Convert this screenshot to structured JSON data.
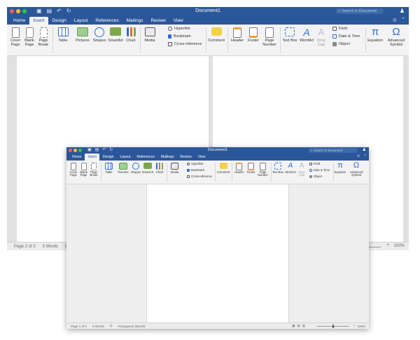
{
  "app": {
    "document_title": "Document1",
    "search_placeholder": "Search in Document"
  },
  "ribbon_tabs": [
    "Home",
    "Insert",
    "Design",
    "Layout",
    "References",
    "Mailings",
    "Review",
    "View"
  ],
  "active_tab": "Insert",
  "ribbon": {
    "cover_page": "Cover Page",
    "blank_page": "Blank Page",
    "page_break": "Page Break",
    "table": "Table",
    "pictures": "Pictures",
    "shapes": "Shapes",
    "smartart": "SmartArt",
    "chart": "Chart",
    "media": "Media",
    "hyperlink": "Hyperlink",
    "bookmark": "Bookmark",
    "cross_reference": "Cross-reference",
    "comment": "Comment",
    "header": "Header",
    "footer": "Footer",
    "page_number": "Page Number",
    "text_box": "Text Box",
    "wordart": "WordArt",
    "drop_cap": "Drop Cap",
    "field": "Field",
    "date_time": "Date & Time",
    "object": "Object",
    "equation": "Equation",
    "advanced_symbol": "Advanced Symbol"
  },
  "status_back": {
    "page": "Page 2 of 2",
    "words": "0 Words",
    "zoom": "100%"
  },
  "status_front": {
    "page": "Page 1 of 1",
    "words": "0 Words",
    "language": "Portuguese (Brazil)",
    "zoom": "100%"
  },
  "colors": {
    "title_bar": "#2b579a",
    "ribbon_bg": "#f3f3f3",
    "window_close": "#fd5f57",
    "window_min": "#fdbc2e",
    "window_max": "#28c840",
    "accent_blue": "#2f6dd0"
  },
  "icons": {
    "search": "magnifier",
    "user": "person-plus",
    "settings": "smiley",
    "collapse": "chevron-up",
    "undo": "curved-arrow-left",
    "redo": "circular-arrow"
  }
}
